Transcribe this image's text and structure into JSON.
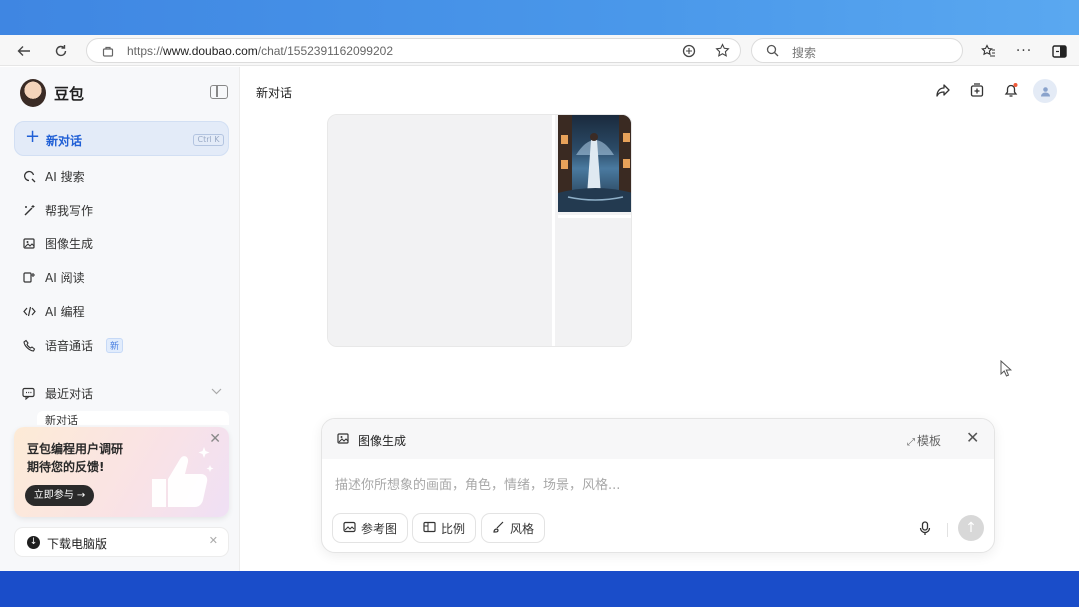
{
  "browser": {
    "url_prefix": "https://",
    "url_host": "www.doubao.com",
    "url_path": "/chat/1552391162099202",
    "search_placeholder": "搜索"
  },
  "sidebar": {
    "app_name": "豆包",
    "new_chat": {
      "label": "新对话",
      "shortcut": "Ctrl K"
    },
    "items": [
      {
        "label": "AI 搜索",
        "icon": "search-sparkle-icon"
      },
      {
        "label": "帮我写作",
        "icon": "wand-icon"
      },
      {
        "label": "图像生成",
        "icon": "image-icon"
      },
      {
        "label": "AI 阅读",
        "icon": "read-icon"
      },
      {
        "label": "AI 编程",
        "icon": "code-icon"
      },
      {
        "label": "语音通话",
        "icon": "phone-icon",
        "badge": "新"
      }
    ],
    "recent": {
      "label": "最近对话",
      "partial_item": "新对话"
    },
    "promo": {
      "line1": "豆包编程用户调研",
      "line2": "期待您的反馈!",
      "button": "立即参与 →"
    },
    "download": {
      "label": "下载电脑版"
    }
  },
  "main": {
    "title": "新对话",
    "composer": {
      "mode_label": "图像生成",
      "template_label": "模板",
      "placeholder": "描述你所想象的画面，角色，情绪，场景，风格...",
      "chips": [
        {
          "label": "参考图",
          "icon": "image-ref-icon"
        },
        {
          "label": "比例",
          "icon": "ratio-icon"
        },
        {
          "label": "风格",
          "icon": "brush-icon"
        }
      ]
    }
  },
  "colors": {
    "accent": "#1f5fd6",
    "sidebar_bg": "#f7f8fa",
    "new_chat_bg": "#e3ebf8"
  }
}
